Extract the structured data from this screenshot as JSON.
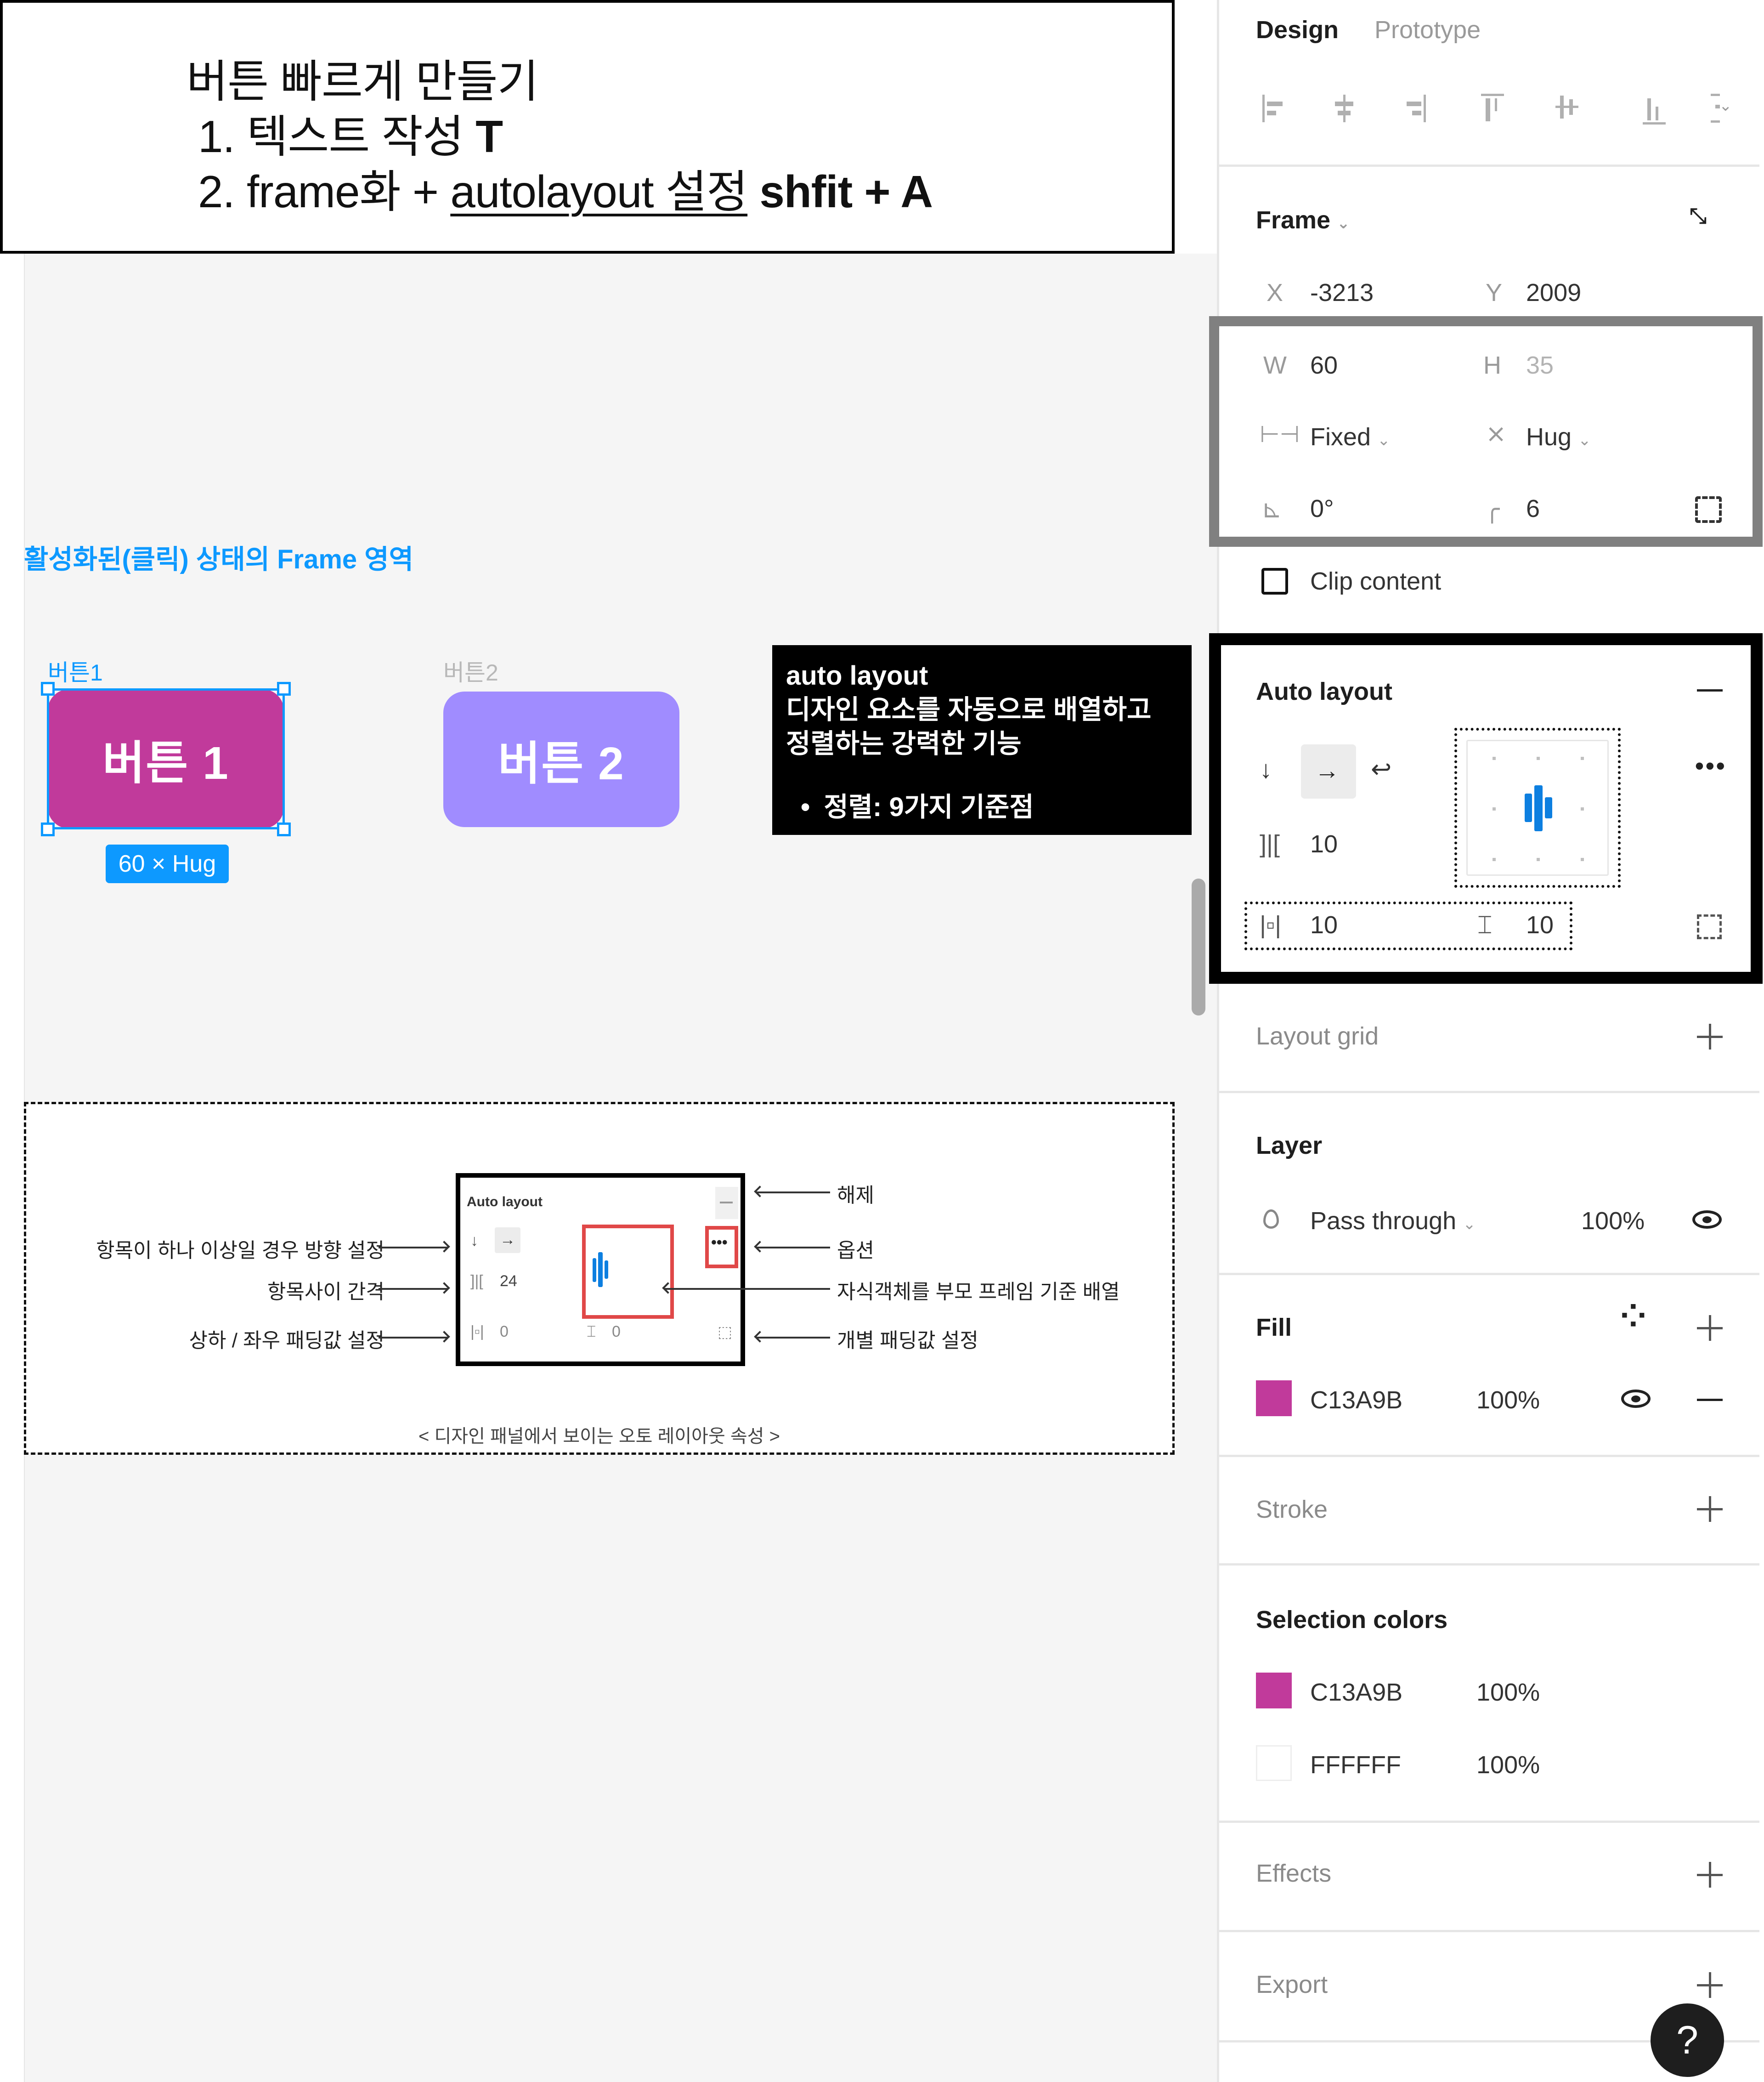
{
  "title_note": {
    "heading": "버튼 빠르게 만들기",
    "step1_text": "1. 텍스트 작성 ",
    "step1_key": "T",
    "step2_prefix": "2. frame화 + ",
    "step2_underlined": "autolayout 설정",
    "step2_key": " shfit + A"
  },
  "canvas": {
    "frame_area_label": "활성화된(클릭) 상태의 Frame 영역",
    "button1": {
      "layer_name": "버튼1",
      "text": "버튼 1",
      "color": "#C13A9B",
      "selected": true,
      "size_badge": "60 × Hug"
    },
    "button2": {
      "layer_name": "버튼2",
      "text": "버튼 2",
      "color": "#A08CFF",
      "selected": false
    },
    "info_box": {
      "title": "auto layout",
      "line1": "디자인 요소를 자동으로 배열하고",
      "line2": "정렬하는 강력한 기능",
      "bullet": "정렬: 9가지 기준점"
    },
    "diagram": {
      "left_labels": [
        "항목이 하나 이상일 경우 방향 설정",
        "항목사이 간격",
        "상하 / 좌우 패딩값 설정"
      ],
      "right_labels": [
        "해제",
        "옵션",
        "자식객체를 부모 프레임 기준 배열",
        "개별 패딩값 설정"
      ],
      "mini_panel": {
        "title": "Auto layout",
        "gap": "24",
        "h_padding": "0",
        "v_padding": "0"
      },
      "caption": "< 디자인 패널에서 보이는 오토 레이아웃 속성 >"
    }
  },
  "panel": {
    "tabs": [
      {
        "label": "Design",
        "active": true
      },
      {
        "label": "Prototype",
        "active": false
      }
    ],
    "align_icons": [
      "align-left",
      "align-horizontal-center",
      "align-right",
      "align-top",
      "align-vertical-center",
      "align-bottom",
      "distribute"
    ],
    "frame": {
      "title": "Frame",
      "x_label": "X",
      "x_value": "-3213",
      "y_label": "Y",
      "y_value": "2009",
      "w_label": "W",
      "w_value": "60",
      "h_label": "H",
      "h_value": "35",
      "width_mode": "Fixed",
      "height_mode": "Hug",
      "rotation": "0°",
      "corner_radius": "6",
      "clip_content_label": "Clip content",
      "clip_content_checked": false
    },
    "auto_layout": {
      "title": "Auto layout",
      "direction": "horizontal",
      "gap": "10",
      "h_padding": "10",
      "v_padding": "10",
      "alignment": "center-left"
    },
    "layout_grid": {
      "title": "Layout grid"
    },
    "layer": {
      "title": "Layer",
      "blend_mode": "Pass through",
      "opacity": "100%"
    },
    "fill": {
      "title": "Fill",
      "color_hex": "C13A9B",
      "color": "#C13A9B",
      "opacity": "100%"
    },
    "stroke": {
      "title": "Stroke"
    },
    "selection_colors": {
      "title": "Selection colors",
      "items": [
        {
          "hex": "C13A9B",
          "color": "#C13A9B",
          "opacity": "100%"
        },
        {
          "hex": "FFFFFF",
          "color": "#FFFFFF",
          "opacity": "100%"
        }
      ]
    },
    "effects": {
      "title": "Effects"
    },
    "export": {
      "title": "Export"
    },
    "help_label": "?"
  }
}
